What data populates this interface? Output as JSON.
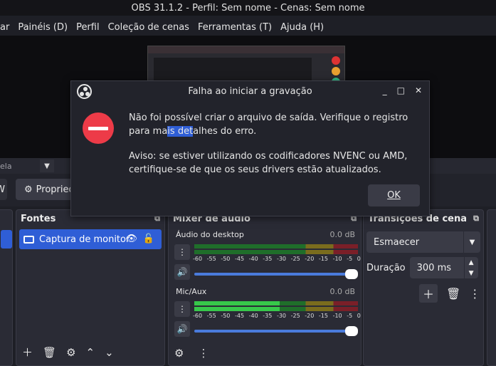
{
  "window": {
    "title": "OBS 31.1.2 - Perfil: Sem nome - Cenas: Sem nome"
  },
  "menu": [
    "ar",
    "Painéis (D)",
    "Perfil",
    "Coleção de cenas",
    "Ferramentas (T)",
    "Ajuda (H)"
  ],
  "scene_strip": {
    "label": "ela",
    "dropdown": "▼"
  },
  "props": {
    "left_label": "W",
    "button_label": "Propriedades"
  },
  "sources": {
    "title": "Fontes",
    "item_label": "Captura de monitor",
    "icons": [
      "plus-icon",
      "trash-icon",
      "gear-icon",
      "chevron-up-icon",
      "chevron-down-icon"
    ]
  },
  "mixer": {
    "title": "Mixer de áudio",
    "channels": [
      {
        "name": "Áudio do desktop",
        "db": "0.0 dB",
        "level": 0.0
      },
      {
        "name": "Mic/Aux",
        "db": "0.0 dB",
        "level": 0.52
      }
    ],
    "ticks": [
      "-60",
      "-55",
      "-50",
      "-45",
      "-40",
      "-35",
      "-30",
      "-25",
      "-20",
      "-15",
      "-10",
      "-5",
      "0"
    ]
  },
  "transitions": {
    "title": "Transições de cena",
    "selected": "Esmaecer",
    "duration_label": "Duração",
    "duration_value": "300 ms"
  },
  "dialog": {
    "title": "Falha ao iniciar a gravação",
    "message1_a": "Não foi possível criar o arquivo de saída. Verifique o registro para ma",
    "message1_hl": "is det",
    "message1_b": "alhes do erro.",
    "message2": "Aviso: se estiver utilizando os codificadores NVENC ou AMD, certifique-se de que os seus drivers estão atualizados.",
    "ok_label": "OK",
    "controls": {
      "min": "_",
      "max": "□",
      "close": "✕"
    }
  },
  "colors": {
    "accent": "#2f5ed6",
    "error": "#ed3b48"
  }
}
